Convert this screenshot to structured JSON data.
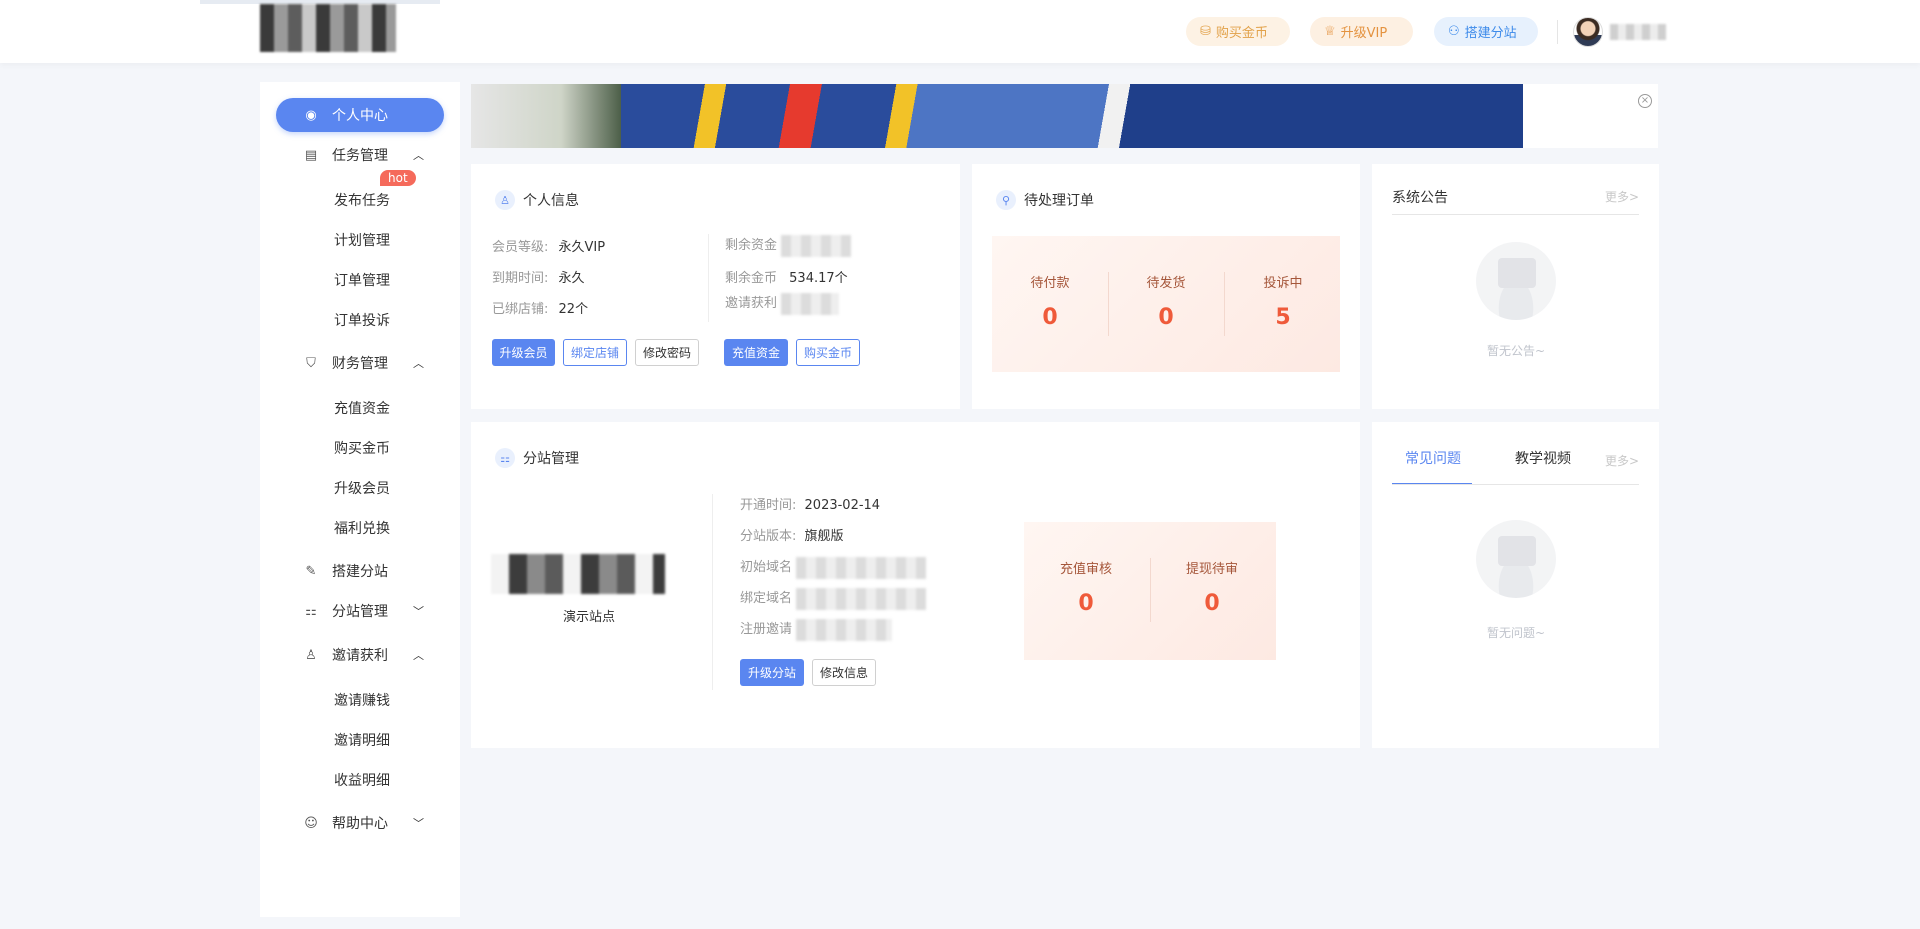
{
  "header": {
    "buy_gold": "购买金币",
    "upgrade_vip": "升级VIP",
    "build_site": "搭建分站"
  },
  "sidebar": {
    "personal_center": "个人中心",
    "task_mgmt": "任务管理",
    "hot_badge": "hot",
    "task_sub": [
      "发布任务",
      "计划管理",
      "订单管理",
      "订单投诉"
    ],
    "finance_mgmt": "财务管理",
    "finance_sub": [
      "充值资金",
      "购买金币",
      "升级会员",
      "福利兑换"
    ],
    "build_site": "搭建分站",
    "site_mgmt": "分站管理",
    "invite": "邀请获利",
    "invite_sub": [
      "邀请赚钱",
      "邀请明细",
      "收益明细"
    ],
    "help": "帮助中心"
  },
  "personal": {
    "title": "个人信息",
    "level_label": "会员等级:",
    "level_value": "永久VIP",
    "expire_label": "到期时间:",
    "expire_value": "永久",
    "shops_label": "已绑店铺:",
    "shops_value": "22个",
    "funds_label": "剩余资金",
    "gold_label": "剩余金币",
    "gold_value": "534.17个",
    "invite_label": "邀请获利",
    "btn_upgrade": "升级会员",
    "btn_bind": "绑定店铺",
    "btn_password": "修改密码",
    "btn_recharge": "充值资金",
    "btn_buy_gold": "购买金币"
  },
  "pending": {
    "title": "待处理订单",
    "items": [
      {
        "label": "待付款",
        "value": "0"
      },
      {
        "label": "待发货",
        "value": "0"
      },
      {
        "label": "投诉中",
        "value": "5"
      }
    ]
  },
  "notice": {
    "title": "系统公告",
    "more": "更多>",
    "empty": "暂无公告~"
  },
  "substation": {
    "title": "分站管理",
    "site_name": "演示站点",
    "open_label": "开通时间:",
    "open_value": "2023-02-14",
    "version_label": "分站版本:",
    "version_value": "旗舰版",
    "init_domain_label": "初始域名",
    "bind_domain_label": "绑定域名",
    "reg_invite_label": "注册邀请",
    "btn_upgrade": "升级分站",
    "btn_edit": "修改信息",
    "stats": [
      {
        "label": "充值审核",
        "value": "0"
      },
      {
        "label": "提现待审",
        "value": "0"
      }
    ]
  },
  "faq": {
    "tab_faq": "常见问题",
    "tab_video": "教学视频",
    "more": "更多>",
    "empty": "暂无问题~"
  }
}
